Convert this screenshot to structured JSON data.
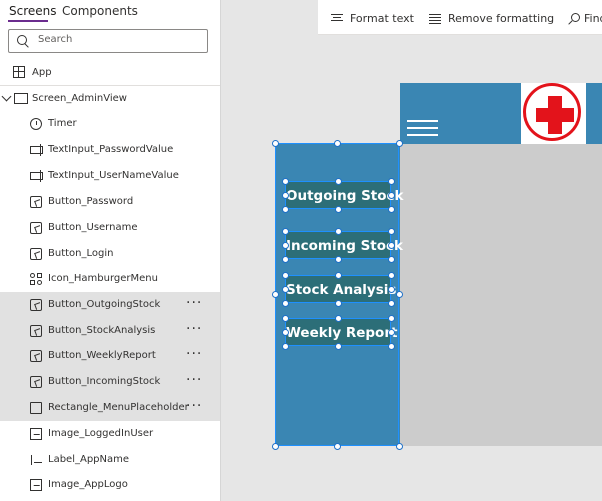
{
  "tabs": {
    "screens": "Screens",
    "components": "Components"
  },
  "search": {
    "placeholder": "Search"
  },
  "tree": {
    "app_label": "App",
    "screen_label": "Screen_AdminView",
    "items": [
      {
        "label": "Timer",
        "icon": "timer-icon",
        "selected": false
      },
      {
        "label": "TextInput_PasswordValue",
        "icon": "text-input-icon",
        "selected": false
      },
      {
        "label": "TextInput_UserNameValue",
        "icon": "text-input-icon",
        "selected": false
      },
      {
        "label": "Button_Password",
        "icon": "button-icon",
        "selected": false
      },
      {
        "label": "Button_Username",
        "icon": "button-icon",
        "selected": false
      },
      {
        "label": "Button_Login",
        "icon": "button-icon",
        "selected": false
      },
      {
        "label": "Icon_HamburgerMenu",
        "icon": "icons-icon",
        "selected": false
      },
      {
        "label": "Button_OutgoingStock",
        "icon": "button-icon",
        "selected": true
      },
      {
        "label": "Button_StockAnalysis",
        "icon": "button-icon",
        "selected": true
      },
      {
        "label": "Button_WeeklyReport",
        "icon": "button-icon",
        "selected": true
      },
      {
        "label": "Button_IncomingStock",
        "icon": "button-icon",
        "selected": true
      },
      {
        "label": "Rectangle_MenuPlaceholder",
        "icon": "rectangle-icon",
        "selected": true
      },
      {
        "label": "Image_LoggedInUser",
        "icon": "image-icon",
        "selected": false
      },
      {
        "label": "Label_AppName",
        "icon": "label-icon",
        "selected": false
      },
      {
        "label": "Image_AppLogo",
        "icon": "image-icon",
        "selected": false
      }
    ],
    "more_label": "···"
  },
  "toolbar": {
    "format_text": "Format text",
    "remove_formatting": "Remove formatting",
    "find": "Find"
  },
  "canvas": {
    "buttons": [
      "Outgoing Stock",
      "Incoming Stock",
      "Stock Analysis",
      "Weekly Report"
    ]
  },
  "colors": {
    "header": "#3a86b3",
    "button": "#2c6e78",
    "accent": "#6b2c8e",
    "cross": "#e3131b"
  }
}
